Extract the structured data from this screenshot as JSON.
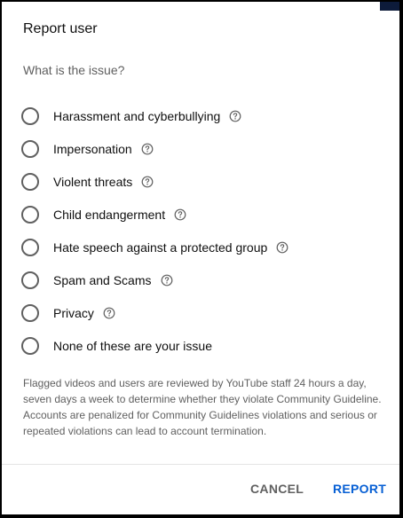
{
  "dialog": {
    "title": "Report user",
    "question": "What is the issue?",
    "options": [
      {
        "label": "Harassment and cyberbullying",
        "help": true,
        "help_icon": "help-circle-icon"
      },
      {
        "label": "Impersonation",
        "help": true,
        "help_icon": "help-circle-icon"
      },
      {
        "label": "Violent threats",
        "help": true,
        "help_icon": "help-circle-icon"
      },
      {
        "label": "Child endangerment",
        "help": true,
        "help_icon": "help-circle-icon"
      },
      {
        "label": "Hate speech against a protected group",
        "help": true,
        "help_icon": "help-circle-icon"
      },
      {
        "label": "Spam and Scams",
        "help": true,
        "help_icon": "help-circle-icon"
      },
      {
        "label": "Privacy",
        "help": true,
        "help_icon": "help-circle-icon"
      },
      {
        "label": "None of these are your issue",
        "help": false
      }
    ],
    "disclaimer": "Flagged videos and users are reviewed by YouTube staff 24 hours a day, seven days a week to determine whether they violate Community Guideline. Accounts are penalized for Community Guidelines violations and serious or repeated violations can lead to account termination.",
    "cancel_label": "CANCEL",
    "report_label": "REPORT"
  },
  "colors": {
    "primary_text": "#0f0f0f",
    "secondary_text": "#606060",
    "accent": "#065fd4",
    "background": "#ffffff"
  }
}
